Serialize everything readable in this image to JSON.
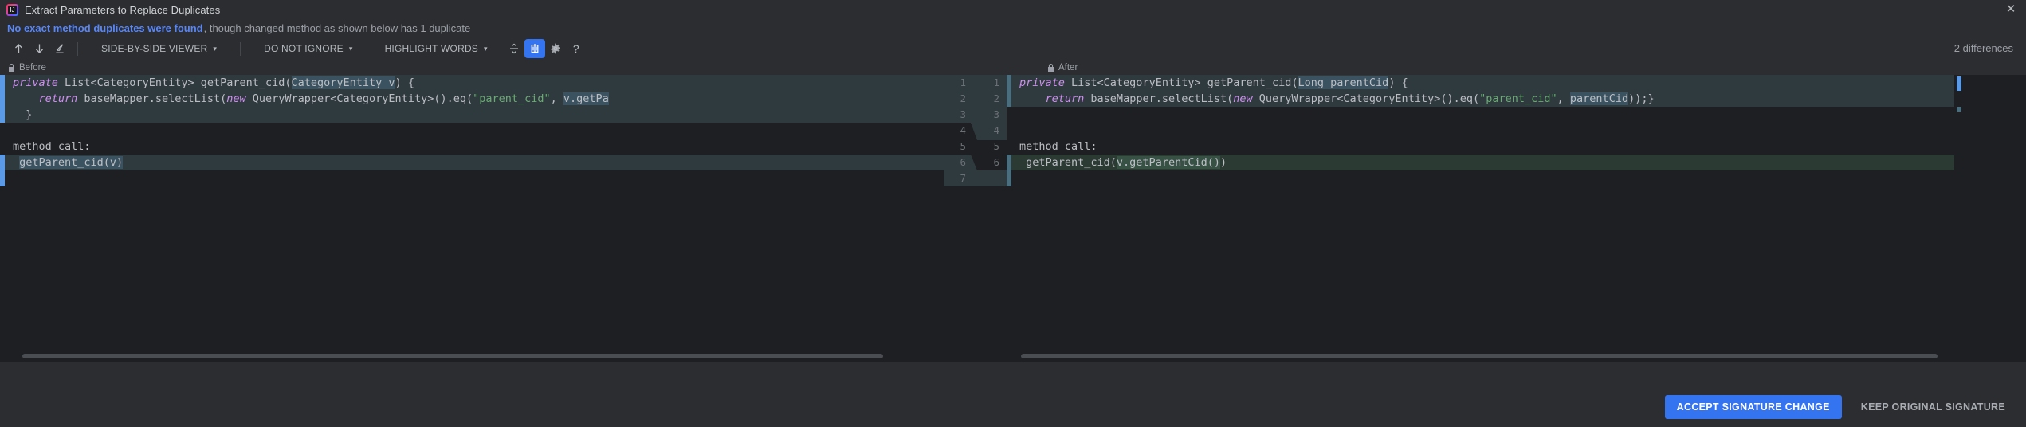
{
  "window": {
    "title": "Extract Parameters to Replace Duplicates",
    "app_icon": "intellij-idea-icon",
    "close_icon": "close-icon"
  },
  "info": {
    "strong": "No exact method duplicates were found",
    "rest": ", though changed method as shown below has 1 duplicate"
  },
  "toolbar": {
    "prev_diff_icon": "arrow-up-icon",
    "next_diff_icon": "arrow-down-icon",
    "apply_icon": "pencil-underline-icon",
    "viewer_mode": "SIDE-BY-SIDE VIEWER",
    "ignore_policy": "DO NOT IGNORE",
    "highlight_mode": "HIGHLIGHT WORDS",
    "collapse_icon": "collapse-unchanged-icon",
    "align_icon": "align-columns-icon",
    "settings_icon": "gear-icon",
    "help_icon": "question-mark-icon",
    "caret": "▾",
    "differences": "2 differences"
  },
  "panes": {
    "left": {
      "label": "Before",
      "lock_icon": "lock-icon",
      "lines": [
        {
          "id": "l1",
          "state": "modified",
          "segments": [
            {
              "text": "private",
              "cls": "kw"
            },
            {
              "text": " List<CategoryEntity> getParent_cid(",
              "cls": "plain"
            },
            {
              "text": "CategoryEntity v",
              "cls": "plain inline-mod"
            },
            {
              "text": ") {",
              "cls": "plain"
            }
          ]
        },
        {
          "id": "l2",
          "state": "modified",
          "segments": [
            {
              "text": "    ",
              "cls": "plain"
            },
            {
              "text": "return",
              "cls": "kw"
            },
            {
              "text": " baseMapper.selectList(",
              "cls": "plain"
            },
            {
              "text": "new",
              "cls": "kw"
            },
            {
              "text": " QueryWrapper<CategoryEntity>().eq(",
              "cls": "plain"
            },
            {
              "text": "\"parent_cid\"",
              "cls": "str"
            },
            {
              "text": ", ",
              "cls": "plain"
            },
            {
              "text": "v.getPa",
              "cls": "plain inline-mod"
            }
          ]
        },
        {
          "id": "l3",
          "state": "modified",
          "segments": [
            {
              "text": "  }",
              "cls": "plain"
            }
          ]
        },
        {
          "id": "l4",
          "state": "normal",
          "segments": []
        },
        {
          "id": "l5",
          "state": "normal",
          "segments": [
            {
              "text": "method call:",
              "cls": "plain"
            }
          ]
        },
        {
          "id": "l6",
          "state": "modified",
          "segments": [
            {
              "text": " ",
              "cls": "plain"
            },
            {
              "text": "getParent_cid(v)",
              "cls": "plain inline-mod"
            }
          ]
        },
        {
          "id": "l7",
          "state": "normal",
          "segments": []
        }
      ]
    },
    "right": {
      "label": "After",
      "lock_icon": "lock-icon",
      "lines": [
        {
          "id": "r1",
          "state": "modified",
          "segments": [
            {
              "text": "private",
              "cls": "kw"
            },
            {
              "text": " List<CategoryEntity> getParent_cid(",
              "cls": "plain"
            },
            {
              "text": "Long parentCid",
              "cls": "plain inline-mod"
            },
            {
              "text": ") {",
              "cls": "plain"
            }
          ]
        },
        {
          "id": "r2",
          "state": "modified",
          "segments": [
            {
              "text": "    ",
              "cls": "plain"
            },
            {
              "text": "return",
              "cls": "kw"
            },
            {
              "text": " baseMapper.selectList(",
              "cls": "plain"
            },
            {
              "text": "new",
              "cls": "kw"
            },
            {
              "text": " QueryWrapper<CategoryEntity>().eq(",
              "cls": "plain"
            },
            {
              "text": "\"parent_cid\"",
              "cls": "str"
            },
            {
              "text": ", ",
              "cls": "plain"
            },
            {
              "text": "parentCid",
              "cls": "plain inline-mod"
            },
            {
              "text": "));}",
              "cls": "plain"
            }
          ]
        },
        {
          "id": "r3",
          "state": "normal",
          "segments": []
        },
        {
          "id": "r4",
          "state": "normal",
          "segments": []
        },
        {
          "id": "r5",
          "state": "normal",
          "segments": [
            {
              "text": "method call:",
              "cls": "plain"
            }
          ]
        },
        {
          "id": "r6",
          "state": "added",
          "segments": [
            {
              "text": " getParent_cid(",
              "cls": "plain"
            },
            {
              "text": "v.getParentCid()",
              "cls": "plain inline-add"
            },
            {
              "text": ")",
              "cls": "plain"
            }
          ]
        }
      ]
    }
  },
  "gutter": {
    "left_numbers": [
      "1",
      "2",
      "3",
      "4",
      "5",
      "6",
      "7"
    ],
    "right_numbers": [
      "1",
      "2",
      "3",
      "4",
      "5",
      "6"
    ]
  },
  "footer": {
    "accept_label": "ACCEPT SIGNATURE CHANGE",
    "keep_label": "KEEP ORIGINAL SIGNATURE"
  },
  "colors": {
    "accent": "#3574f0",
    "link": "#5a87f7",
    "editor_bg": "#1e1f22",
    "chrome_bg": "#2b2d30",
    "modified": "#2f3a3f",
    "added": "#2b3a33",
    "inline_modified": "#3b5360",
    "inline_added": "#375145",
    "string": "#6aab73",
    "keyword": "#cf8ef0"
  }
}
